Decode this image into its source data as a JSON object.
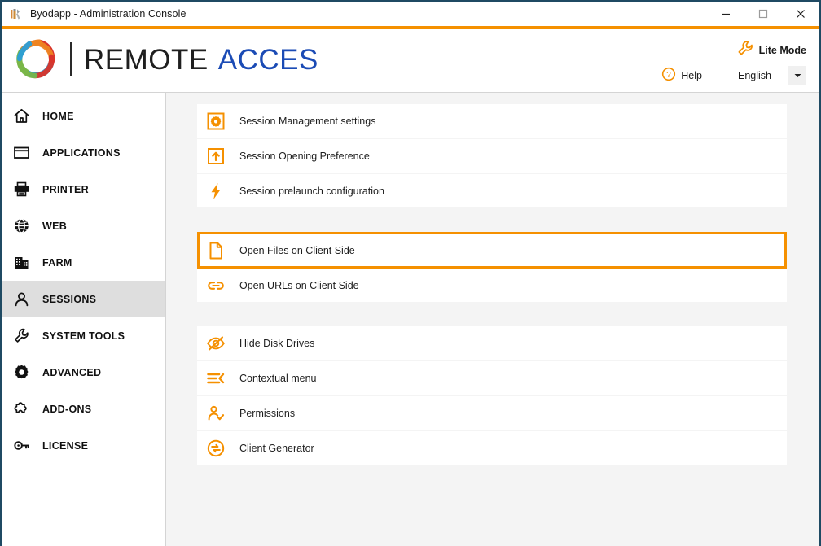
{
  "window": {
    "title": "Byodapp - Administration Console",
    "title_icon": "tools-icon",
    "controls": [
      {
        "name": "minimize",
        "icon": "minimize-icon"
      },
      {
        "name": "maximize",
        "icon": "maximize-icon"
      },
      {
        "name": "close",
        "icon": "close-icon"
      }
    ],
    "accent_color": "#f59000",
    "border_color": "#1f4a63"
  },
  "header": {
    "logo_word1": "REMOTE",
    "logo_word2": "ACCES",
    "logo_word2_color": "#1b4bb5",
    "lite_mode": {
      "label": "Lite Mode",
      "icon": "wrench-icon"
    },
    "help": {
      "label": "Help",
      "icon": "question-circle-icon"
    },
    "language": {
      "value": "English",
      "icon": "chevron-down-icon"
    }
  },
  "sidebar": {
    "active_index": 5,
    "items": [
      {
        "label": "HOME",
        "icon": "home-icon"
      },
      {
        "label": "APPLICATIONS",
        "icon": "window-icon"
      },
      {
        "label": "PRINTER",
        "icon": "printer-icon"
      },
      {
        "label": "WEB",
        "icon": "globe-icon"
      },
      {
        "label": "FARM",
        "icon": "building-icon"
      },
      {
        "label": "SESSIONS",
        "icon": "user-icon"
      },
      {
        "label": "SYSTEM TOOLS",
        "icon": "wrench-icon"
      },
      {
        "label": "ADVANCED",
        "icon": "gear-icon"
      },
      {
        "label": "ADD-ONS",
        "icon": "puzzle-icon"
      },
      {
        "label": "LICENSE",
        "icon": "key-icon"
      }
    ]
  },
  "content": {
    "accent_color": "#f59000",
    "groups": [
      {
        "items": [
          {
            "label": "Session Management settings",
            "icon": "gear-box-icon",
            "selected": false
          },
          {
            "label": "Session Opening Preference",
            "icon": "upload-box-icon",
            "selected": false
          },
          {
            "label": "Session prelaunch configuration",
            "icon": "bolt-icon",
            "selected": false
          }
        ]
      },
      {
        "items": [
          {
            "label": "Open Files on Client Side",
            "icon": "file-icon",
            "selected": true
          },
          {
            "label": "Open URLs on Client Side",
            "icon": "link-icon",
            "selected": false
          }
        ]
      },
      {
        "items": [
          {
            "label": "Hide Disk Drives",
            "icon": "eye-off-icon",
            "selected": false
          },
          {
            "label": "Contextual menu",
            "icon": "menu-collapse-icon",
            "selected": false
          },
          {
            "label": "Permissions",
            "icon": "user-check-icon",
            "selected": false
          },
          {
            "label": "Client Generator",
            "icon": "client-generator-icon",
            "selected": false
          }
        ]
      }
    ]
  }
}
